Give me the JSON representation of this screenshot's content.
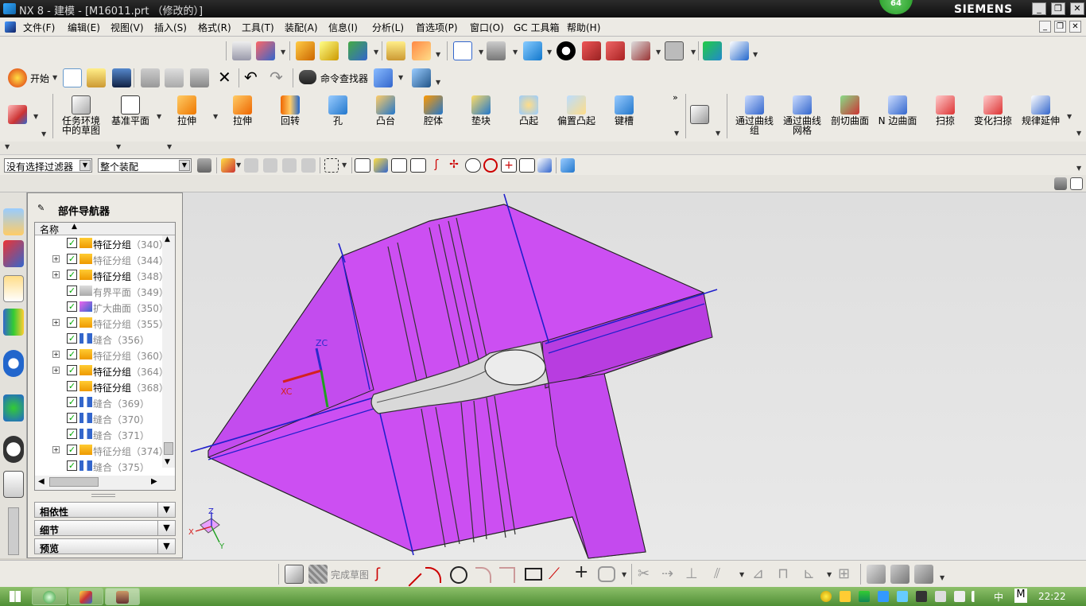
{
  "window": {
    "title": "NX 8 - 建模 - [M16011.prt （修改的）]",
    "brand": "SIEMENS",
    "badge": "64"
  },
  "menu": [
    "文件(F)",
    "编辑(E)",
    "视图(V)",
    "插入(S)",
    "格式(R)",
    "工具(T)",
    "装配(A)",
    "信息(I)",
    "分析(L)",
    "首选项(P)",
    "窗口(O)",
    "GC 工具箱",
    "帮助(H)"
  ],
  "standard": {
    "start_label": "开始",
    "finder_label": "命令查找器"
  },
  "features": [
    {
      "label": "任务环境中的草图",
      "icon": "sketch-task-icon"
    },
    {
      "label": "基准平面",
      "icon": "datum-plane-icon"
    },
    {
      "label": "拉伸",
      "icon": "extrude-icon"
    },
    {
      "label": "拉伸",
      "icon": "extrude-icon"
    },
    {
      "label": "回转",
      "icon": "revolve-icon"
    },
    {
      "label": "孔",
      "icon": "hole-icon"
    },
    {
      "label": "凸台",
      "icon": "boss-icon"
    },
    {
      "label": "腔体",
      "icon": "pocket-icon"
    },
    {
      "label": "垫块",
      "icon": "pad-icon"
    },
    {
      "label": "凸起",
      "icon": "emboss-icon"
    },
    {
      "label": "偏置凸起",
      "icon": "offset-emboss-icon"
    },
    {
      "label": "键槽",
      "icon": "slot-icon"
    }
  ],
  "surfaces": [
    {
      "label": "通过曲线组",
      "icon": "through-curves-icon"
    },
    {
      "label": "通过曲线网格",
      "icon": "curve-mesh-icon"
    },
    {
      "label": "剖切曲面",
      "icon": "section-surface-icon"
    },
    {
      "label": "N 边曲面",
      "icon": "n-sided-surface-icon"
    },
    {
      "label": "扫掠",
      "icon": "swept-icon"
    },
    {
      "label": "变化扫掠",
      "icon": "variational-sweep-icon"
    },
    {
      "label": "规律延伸",
      "icon": "law-extension-icon"
    }
  ],
  "filter": {
    "type_filter": "没有选择过滤器",
    "scope": "整个装配"
  },
  "navigator": {
    "title": "部件导航器",
    "column_name": "名称",
    "rows": [
      {
        "label": "特征分组",
        "num": "（340）",
        "expand": "",
        "icon": "feature-group-icon",
        "gray": false
      },
      {
        "label": "特征分组",
        "num": "（344）",
        "expand": "+",
        "icon": "feature-group-icon",
        "gray": true
      },
      {
        "label": "特征分组",
        "num": "（348）",
        "expand": "+",
        "icon": "feature-group-icon",
        "gray": false
      },
      {
        "label": "有界平面",
        "num": "（349）",
        "expand": "",
        "icon": "bounded-plane-icon",
        "gray": true
      },
      {
        "label": "扩大曲面",
        "num": "（350）",
        "expand": "",
        "icon": "enlarge-surface-icon",
        "gray": true
      },
      {
        "label": "特征分组",
        "num": "（355）",
        "expand": "+",
        "icon": "feature-group-icon",
        "gray": true
      },
      {
        "label": "缝合",
        "num": "（356）",
        "expand": "",
        "icon": "sew-icon",
        "gray": true
      },
      {
        "label": "特征分组",
        "num": "（360）",
        "expand": "+",
        "icon": "feature-group-icon",
        "gray": true
      },
      {
        "label": "特征分组",
        "num": "（364）",
        "expand": "+",
        "icon": "feature-group-icon",
        "gray": false
      },
      {
        "label": "特征分组",
        "num": "（368）",
        "expand": "",
        "icon": "feature-group-icon",
        "gray": false
      },
      {
        "label": "缝合",
        "num": "（369）",
        "expand": "",
        "icon": "sew-icon",
        "gray": true
      },
      {
        "label": "缝合",
        "num": "（370）",
        "expand": "",
        "icon": "sew-icon",
        "gray": true
      },
      {
        "label": "缝合",
        "num": "（371）",
        "expand": "",
        "icon": "sew-icon",
        "gray": true
      },
      {
        "label": "特征分组",
        "num": "（374）",
        "expand": "+",
        "icon": "feature-group-icon",
        "gray": true
      },
      {
        "label": "缝合",
        "num": "（375）",
        "expand": "",
        "icon": "sew-icon",
        "gray": true
      }
    ],
    "sections": [
      "相依性",
      "细节",
      "预览"
    ]
  },
  "viewport": {
    "axis_labels": {
      "zc": "ZC",
      "xc": "XC",
      "z": "Z",
      "x": "X",
      "y": "Y"
    },
    "model_color": "#cc4ff2",
    "edge_color": "#1f1fcc"
  },
  "sketch_bar": {
    "finish_label": "完成草图"
  },
  "taskbar": {
    "clock": "22:22",
    "ime": "中",
    "ime2": "M"
  }
}
